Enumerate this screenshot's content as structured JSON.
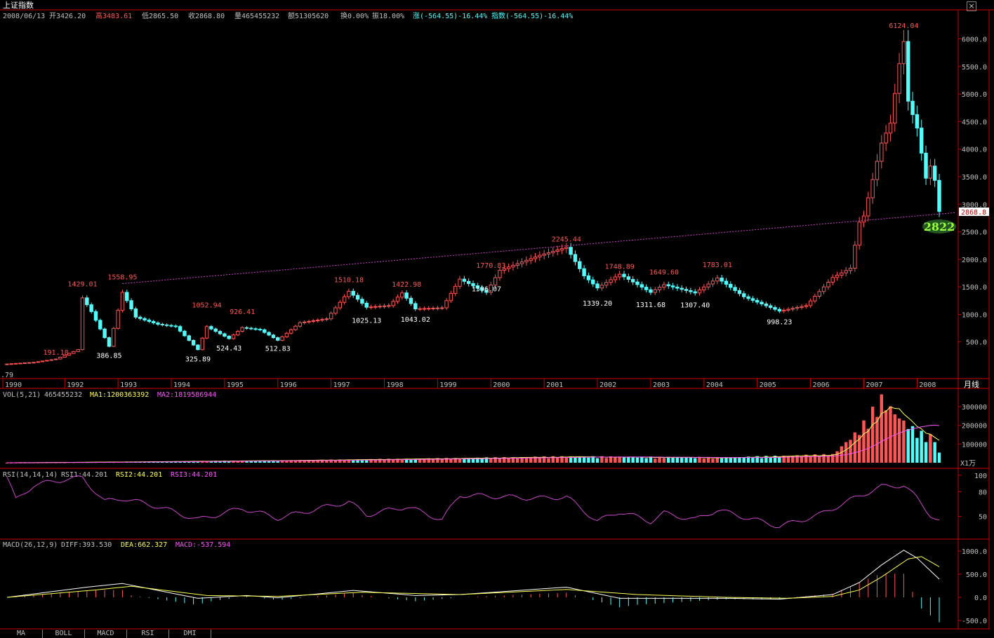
{
  "window": {
    "title": "上证指数",
    "close_label": "×"
  },
  "header": {
    "date": "2008/06/13",
    "open": "开3426.20",
    "high": "高3483.61",
    "low": "低2865.50",
    "close": "收2868.80",
    "volume": "量465455232",
    "amount": "额51305620",
    "turnover": "换0.00%",
    "amplitude": "振18.00%",
    "change": "涨(-564.55)-16.44%",
    "index": "指数(-564.55)-16.44%"
  },
  "colors": {
    "up": "#ff5555",
    "down": "#54fcfc",
    "trendline": "#cc44cc",
    "ma1": "#ffff54",
    "ma2": "#ff54ff",
    "axis": "#cc0000",
    "price_axis_text": "#c0c0c0",
    "white": "#ffffff",
    "highlight": "#9cff3c"
  },
  "main_panel": {
    "period_label": "月线",
    "current_price_label": "2868.8",
    "annotation": "2822",
    "left_edge_label": ".79",
    "y_ticks": [
      "6000.0",
      "5500.0",
      "5000.0",
      "4500.0",
      "4000.0",
      "3500.0",
      "3000.0",
      "2500.0",
      "2000.0",
      "1500.0",
      "1000.0",
      "500.0"
    ],
    "x_ticks": [
      "1990",
      "1992",
      "1993",
      "1994",
      "1995",
      "1996",
      "1997",
      "1998",
      "1999",
      "2000",
      "2001",
      "2002",
      "2003",
      "2004",
      "2005",
      "2006",
      "2007",
      "2008"
    ]
  },
  "vol_panel": {
    "label": "VOL(5,21)",
    "value": "465455232",
    "ma1": "MA1:1200363392",
    "ma2": "MA2:1819586944",
    "unit": "X1万",
    "y_ticks": [
      "300000",
      "200000",
      "100000"
    ]
  },
  "rsi_panel": {
    "label": "RSI(14,14,14)",
    "rsi1": "RSI1:44.201",
    "rsi2": "RSI2:44.201",
    "rsi3": "RSI3:44.201",
    "y_ticks": [
      "100",
      "80",
      "50"
    ]
  },
  "macd_panel": {
    "label": "MACD(26,12,9)",
    "diff": "DIFF:393.530",
    "dea": "DEA:662.327",
    "macd": "MACD:-537.594",
    "y_ticks": [
      "1000.0",
      "500.0",
      "0.0",
      "-500.0"
    ]
  },
  "tabs": [
    "MA",
    "BOLL",
    "MACD",
    "RSI",
    "DMI"
  ],
  "chart_data": {
    "type": "candlestick",
    "period": "monthly",
    "x_range": [
      "1990-12",
      "2008-06"
    ],
    "ylim": [
      0,
      6300
    ],
    "trendline": {
      "from": {
        "date": "1993-02",
        "value": 1558.95
      },
      "to": {
        "date": "2008-06",
        "value": 2822
      }
    },
    "peaks": [
      {
        "date": "1990-12",
        "value": ".79",
        "dir": "low"
      },
      {
        "date": "1991-11",
        "value": "191.18",
        "dir": "high"
      },
      {
        "date": "1992-05",
        "value": "1429.01",
        "dir": "high"
      },
      {
        "date": "1992-11",
        "value": "386.85",
        "dir": "low"
      },
      {
        "date": "1993-02",
        "value": "1558.95",
        "dir": "high"
      },
      {
        "date": "1994-07",
        "value": "325.89",
        "dir": "low"
      },
      {
        "date": "1994-09",
        "value": "1052.94",
        "dir": "high"
      },
      {
        "date": "1995-02",
        "value": "524.43",
        "dir": "low"
      },
      {
        "date": "1995-05",
        "value": "926.41",
        "dir": "high"
      },
      {
        "date": "1996-01",
        "value": "512.83",
        "dir": "low"
      },
      {
        "date": "1997-05",
        "value": "1510.18",
        "dir": "high"
      },
      {
        "date": "1997-09",
        "value": "1025.13",
        "dir": "low"
      },
      {
        "date": "1998-06",
        "value": "1422.98",
        "dir": "high"
      },
      {
        "date": "1998-08",
        "value": "1043.02",
        "dir": "low"
      },
      {
        "date": "2000-01",
        "value": "1770.83",
        "dir": "high"
      },
      {
        "date": "1999-12",
        "value": "1596.07",
        "dir": "low"
      },
      {
        "date": "2001-06",
        "value": "2245.44",
        "dir": "high"
      },
      {
        "date": "2002-01",
        "value": "1339.20",
        "dir": "low"
      },
      {
        "date": "2002-06",
        "value": "1748.89",
        "dir": "high"
      },
      {
        "date": "2003-01",
        "value": "1311.68",
        "dir": "low"
      },
      {
        "date": "2003-04",
        "value": "1649.60",
        "dir": "high"
      },
      {
        "date": "2003-11",
        "value": "1307.40",
        "dir": "low"
      },
      {
        "date": "2004-04",
        "value": "1783.01",
        "dir": "high"
      },
      {
        "date": "2005-06",
        "value": "998.23",
        "dir": "low"
      },
      {
        "date": "2007-10",
        "value": "6124.04",
        "dir": "high"
      }
    ],
    "anchors": [
      [
        "1990-12",
        100
      ],
      [
        "1991-06",
        130
      ],
      [
        "1991-11",
        190
      ],
      [
        "1992-04",
        360
      ],
      [
        "1992-05",
        1300
      ],
      [
        "1992-07",
        1050
      ],
      [
        "1992-11",
        420
      ],
      [
        "1993-02",
        1400
      ],
      [
        "1993-05",
        950
      ],
      [
        "1993-10",
        820
      ],
      [
        "1994-02",
        780
      ],
      [
        "1994-07",
        360
      ],
      [
        "1994-09",
        780
      ],
      [
        "1995-02",
        560
      ],
      [
        "1995-05",
        760
      ],
      [
        "1995-09",
        720
      ],
      [
        "1996-01",
        530
      ],
      [
        "1996-06",
        850
      ],
      [
        "1996-12",
        920
      ],
      [
        "1997-05",
        1420
      ],
      [
        "1997-09",
        1130
      ],
      [
        "1998-02",
        1160
      ],
      [
        "1998-05",
        1390
      ],
      [
        "1998-08",
        1100
      ],
      [
        "1999-02",
        1120
      ],
      [
        "1999-06",
        1640
      ],
      [
        "1999-12",
        1400
      ],
      [
        "2000-03",
        1800
      ],
      [
        "2000-12",
        2073
      ],
      [
        "2001-06",
        2218
      ],
      [
        "2001-10",
        1700
      ],
      [
        "2002-01",
        1480
      ],
      [
        "2002-06",
        1730
      ],
      [
        "2003-01",
        1400
      ],
      [
        "2003-04",
        1540
      ],
      [
        "2003-11",
        1390
      ],
      [
        "2004-04",
        1660
      ],
      [
        "2004-10",
        1320
      ],
      [
        "2005-06",
        1060
      ],
      [
        "2005-12",
        1160
      ],
      [
        "2006-06",
        1670
      ],
      [
        "2006-10",
        1838
      ],
      [
        "2006-12",
        2675
      ],
      [
        "2007-01",
        2786
      ],
      [
        "2007-05",
        4110
      ],
      [
        "2007-07",
        4471
      ],
      [
        "2007-09",
        5552
      ],
      [
        "2007-10",
        5954
      ],
      [
        "2007-11",
        4871
      ],
      [
        "2008-01",
        4383
      ],
      [
        "2008-03",
        3472
      ],
      [
        "2008-04",
        3693
      ],
      [
        "2008-05",
        3433
      ],
      [
        "2008-06",
        2868.8
      ]
    ],
    "volume_anchors": [
      [
        "1990-12",
        0
      ],
      [
        "1993-01",
        4000
      ],
      [
        "1996-06",
        12000
      ],
      [
        "1999-06",
        22000
      ],
      [
        "2001-06",
        30000
      ],
      [
        "2004-06",
        25000
      ],
      [
        "2006-06",
        40000
      ],
      [
        "2006-12",
        160000
      ],
      [
        "2007-05",
        310000
      ],
      [
        "2007-10",
        200000
      ],
      [
        "2008-01",
        150000
      ],
      [
        "2008-05",
        120000
      ],
      [
        "2008-06",
        46546
      ]
    ],
    "rsi_anchors": [
      [
        "1990-12",
        98
      ],
      [
        "1991-02",
        70
      ],
      [
        "1991-06",
        88
      ],
      [
        "1992-01",
        95
      ],
      [
        "1992-05",
        97
      ],
      [
        "1992-10",
        68
      ],
      [
        "1993-02",
        72
      ],
      [
        "1993-10",
        62
      ],
      [
        "1994-07",
        46
      ],
      [
        "1995-05",
        60
      ],
      [
        "1996-01",
        48
      ],
      [
        "1997-05",
        68
      ],
      [
        "1997-09",
        52
      ],
      [
        "1998-06",
        62
      ],
      [
        "1999-02",
        46
      ],
      [
        "1999-06",
        76
      ],
      [
        "2000-12",
        72
      ],
      [
        "2001-06",
        74
      ],
      [
        "2002-01",
        44
      ],
      [
        "2002-06",
        56
      ],
      [
        "2003-01",
        44
      ],
      [
        "2003-04",
        54
      ],
      [
        "2003-11",
        46
      ],
      [
        "2004-04",
        58
      ],
      [
        "2005-06",
        38
      ],
      [
        "2006-03",
        52
      ],
      [
        "2006-12",
        75
      ],
      [
        "2007-05",
        86
      ],
      [
        "2007-10",
        88
      ],
      [
        "2008-01",
        72
      ],
      [
        "2008-04",
        52
      ],
      [
        "2008-06",
        44.201
      ]
    ],
    "macd_anchors": [
      [
        "1990-12",
        0
      ],
      [
        "1992-06",
        220
      ],
      [
        "1993-02",
        300
      ],
      [
        "1994-07",
        -20
      ],
      [
        "1995-06",
        40
      ],
      [
        "1996-01",
        -10
      ],
      [
        "1997-06",
        150
      ],
      [
        "1998-08",
        40
      ],
      [
        "1999-06",
        60
      ],
      [
        "2001-06",
        220
      ],
      [
        "2002-06",
        -20
      ],
      [
        "2004-06",
        -20
      ],
      [
        "2005-06",
        -40
      ],
      [
        "2006-06",
        60
      ],
      [
        "2006-12",
        320
      ],
      [
        "2007-05",
        700
      ],
      [
        "2007-10",
        1020
      ],
      [
        "2008-01",
        850
      ],
      [
        "2008-06",
        393.53
      ]
    ],
    "dea_anchors": [
      [
        "1990-12",
        0
      ],
      [
        "1992-08",
        160
      ],
      [
        "1993-04",
        240
      ],
      [
        "1994-09",
        40
      ],
      [
        "1996-01",
        20
      ],
      [
        "1997-08",
        110
      ],
      [
        "1999-06",
        60
      ],
      [
        "2001-06",
        170
      ],
      [
        "2002-10",
        60
      ],
      [
        "2004-06",
        0
      ],
      [
        "2005-08",
        -20
      ],
      [
        "2006-06",
        20
      ],
      [
        "2006-12",
        160
      ],
      [
        "2007-05",
        440
      ],
      [
        "2007-11",
        830
      ],
      [
        "2008-02",
        880
      ],
      [
        "2008-06",
        662.327
      ]
    ]
  }
}
